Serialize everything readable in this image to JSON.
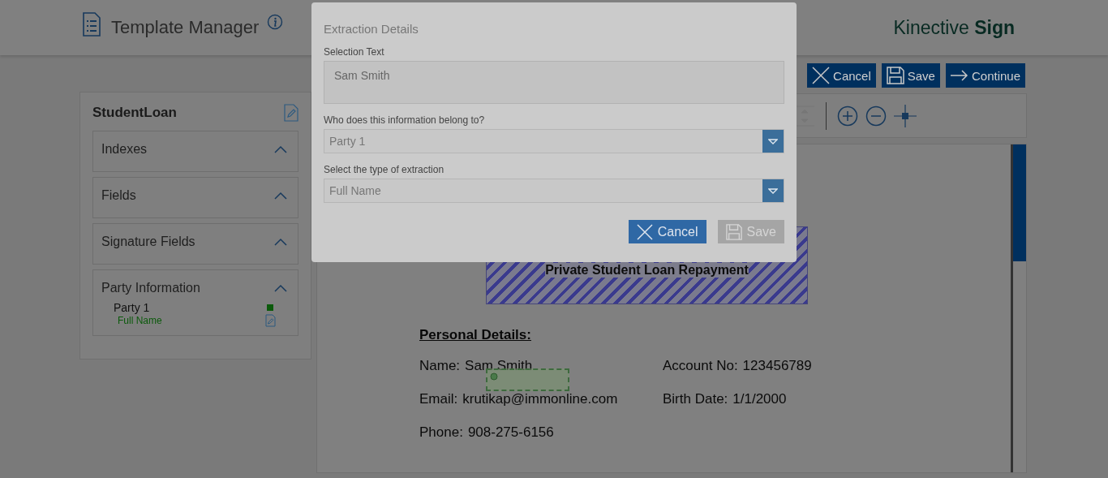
{
  "header": {
    "title": "Template Manager",
    "brand": "Kinective **Sign**"
  },
  "actions": [
    {
      "label": "Cancel",
      "kind": "cancel"
    },
    {
      "label": "Save",
      "kind": "save"
    },
    {
      "label": "Continue",
      "kind": "continue"
    }
  ],
  "sidebar": {
    "title": "StudentLoan",
    "sections": [
      {
        "label": "Indexes",
        "expanded": true
      },
      {
        "label": "Fields",
        "expanded": true
      },
      {
        "label": "Signature Fields",
        "expanded": true
      },
      {
        "label": "Party Information",
        "expanded": true,
        "parties": [
          {
            "name": "Party 1",
            "color": "#0b5a0b",
            "fields": [
              "Full Name"
            ]
          }
        ]
      }
    ]
  },
  "document": {
    "title": "Private Student Loan Repayment",
    "heading": "Personal Details:",
    "rows": [
      [
        {
          "label": "Name:",
          "value": "Sam Smith"
        },
        {
          "label": "Account No:",
          "value": "123456789"
        }
      ],
      [
        {
          "label": "Email:",
          "value": "krutikap@immonline.com"
        },
        {
          "label": "Birth Date:",
          "value": "1/1/2000"
        }
      ],
      [
        {
          "label": "Phone:",
          "value": "908-275-6156"
        }
      ]
    ]
  },
  "modal": {
    "title": "Extraction Details",
    "selection_label": "Selection Text",
    "selection_value": "Sam Smith",
    "owner_label": "Who does this information belong to?",
    "owner_value": "Party 1",
    "type_label": "Select the type of extraction",
    "type_value": "Full Name",
    "buttons": [
      {
        "label": "Cancel",
        "kind": "cancel",
        "disabled": false
      },
      {
        "label": "Save",
        "kind": "save",
        "disabled": true
      }
    ]
  }
}
